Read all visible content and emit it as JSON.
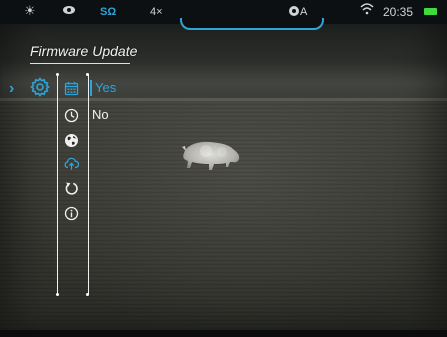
{
  "statusbar": {
    "mic_label": "SΩ",
    "zoom": "4×",
    "mode": "A",
    "time": "20:35",
    "icons": [
      "sun-icon",
      "eye-icon",
      "microphone-icon",
      "mode-gear-icon",
      "wifi-icon",
      "battery-icon"
    ],
    "accent_color": "#2ea4d8",
    "battery_color": "#3ddc3a"
  },
  "menu": {
    "title": "Firmware Update",
    "options": {
      "yes": "Yes",
      "no": "No"
    },
    "selected_option": "yes",
    "icons": [
      "settings-icon",
      "calendar-icon",
      "clock-icon",
      "globe-icon",
      "cloud-upload-icon",
      "reset-icon",
      "info-icon"
    ],
    "active_icon": "cloud-upload-icon"
  }
}
